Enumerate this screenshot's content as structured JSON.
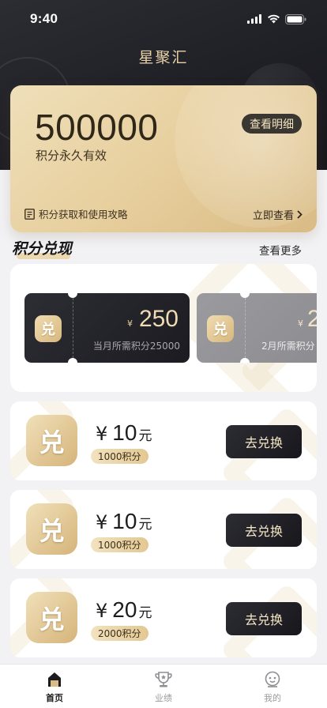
{
  "status_bar": {
    "time": "9:40"
  },
  "app": {
    "title": "星聚汇"
  },
  "points_card": {
    "value": "500000",
    "subtitle": "积分永久有效",
    "detail_button": "查看明细",
    "guide_text": "积分获取和使用攻略",
    "guide_link": "立即查看"
  },
  "section": {
    "title": "积分兑现",
    "more": "查看更多"
  },
  "coupons": [
    {
      "badge": "兑",
      "currency": "¥",
      "amount": "250",
      "requirement": "当月所需积分25000"
    },
    {
      "badge": "兑",
      "currency": "¥",
      "amount": "2",
      "requirement": "2月所需积分"
    }
  ],
  "exchange_items": [
    {
      "badge": "兑",
      "currency": "¥",
      "amount": "10",
      "unit": "元",
      "points": "1000积分",
      "button": "去兑换"
    },
    {
      "badge": "兑",
      "currency": "¥",
      "amount": "10",
      "unit": "元",
      "points": "1000积分",
      "button": "去兑换"
    },
    {
      "badge": "兑",
      "currency": "¥",
      "amount": "20",
      "unit": "元",
      "points": "2000积分",
      "button": "去兑换"
    }
  ],
  "tabbar": {
    "items": [
      {
        "label": "首页",
        "icon": "home-icon",
        "active": true
      },
      {
        "label": "业绩",
        "icon": "trophy-icon",
        "active": false
      },
      {
        "label": "我的",
        "icon": "profile-icon",
        "active": false
      }
    ]
  },
  "colors": {
    "gold": "#e7cf9e",
    "dark": "#1f1f26",
    "accent_text": "#f4e6c5"
  }
}
